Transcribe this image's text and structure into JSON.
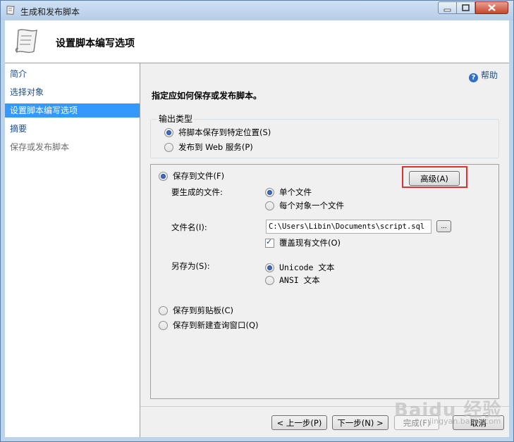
{
  "window": {
    "title": "生成和发布脚本"
  },
  "header": {
    "title": "设置脚本编写选项"
  },
  "sidebar": {
    "items": [
      {
        "label": "简介"
      },
      {
        "label": "选择对象"
      },
      {
        "label": "设置脚本编写选项"
      },
      {
        "label": "摘要"
      },
      {
        "label": "保存或发布脚本"
      }
    ]
  },
  "help": {
    "label": "帮助"
  },
  "instruction": "指定应如何保存或发布脚本。",
  "output_type": {
    "legend": "输出类型",
    "save_to_location": "将脚本保存到特定位置(S)",
    "publish_web": "发布到 Web 服务(P)"
  },
  "save_options": {
    "save_to_file": "保存到文件(F)",
    "advanced_button": "高级(A)",
    "files_to_generate_label": "要生成的文件:",
    "single_file": "单个文件",
    "one_per_object": "每个对象一个文件",
    "filename_label": "文件名(I):",
    "filename_value": "C:\\Users\\Libin\\Documents\\script.sql",
    "browse_button": "...",
    "overwrite": "覆盖现有文件(O)",
    "save_as_label": "另存为(S):",
    "unicode_text": "Unicode 文本",
    "ansi_text": "ANSI 文本",
    "save_to_clipboard": "保存到剪贴板(C)",
    "save_to_query_window": "保存到新建查询窗口(Q)"
  },
  "nav": {
    "back": "< 上一步(P)",
    "next": "下一步(N) >",
    "finish": "完成(F)",
    "cancel": "取消"
  },
  "watermark": {
    "text": "Baidu 经验",
    "sub": "jingyan.baidu.com"
  },
  "colors": {
    "selection": "#3399ff",
    "link": "#1e4f8c",
    "highlight": "#e03030"
  }
}
